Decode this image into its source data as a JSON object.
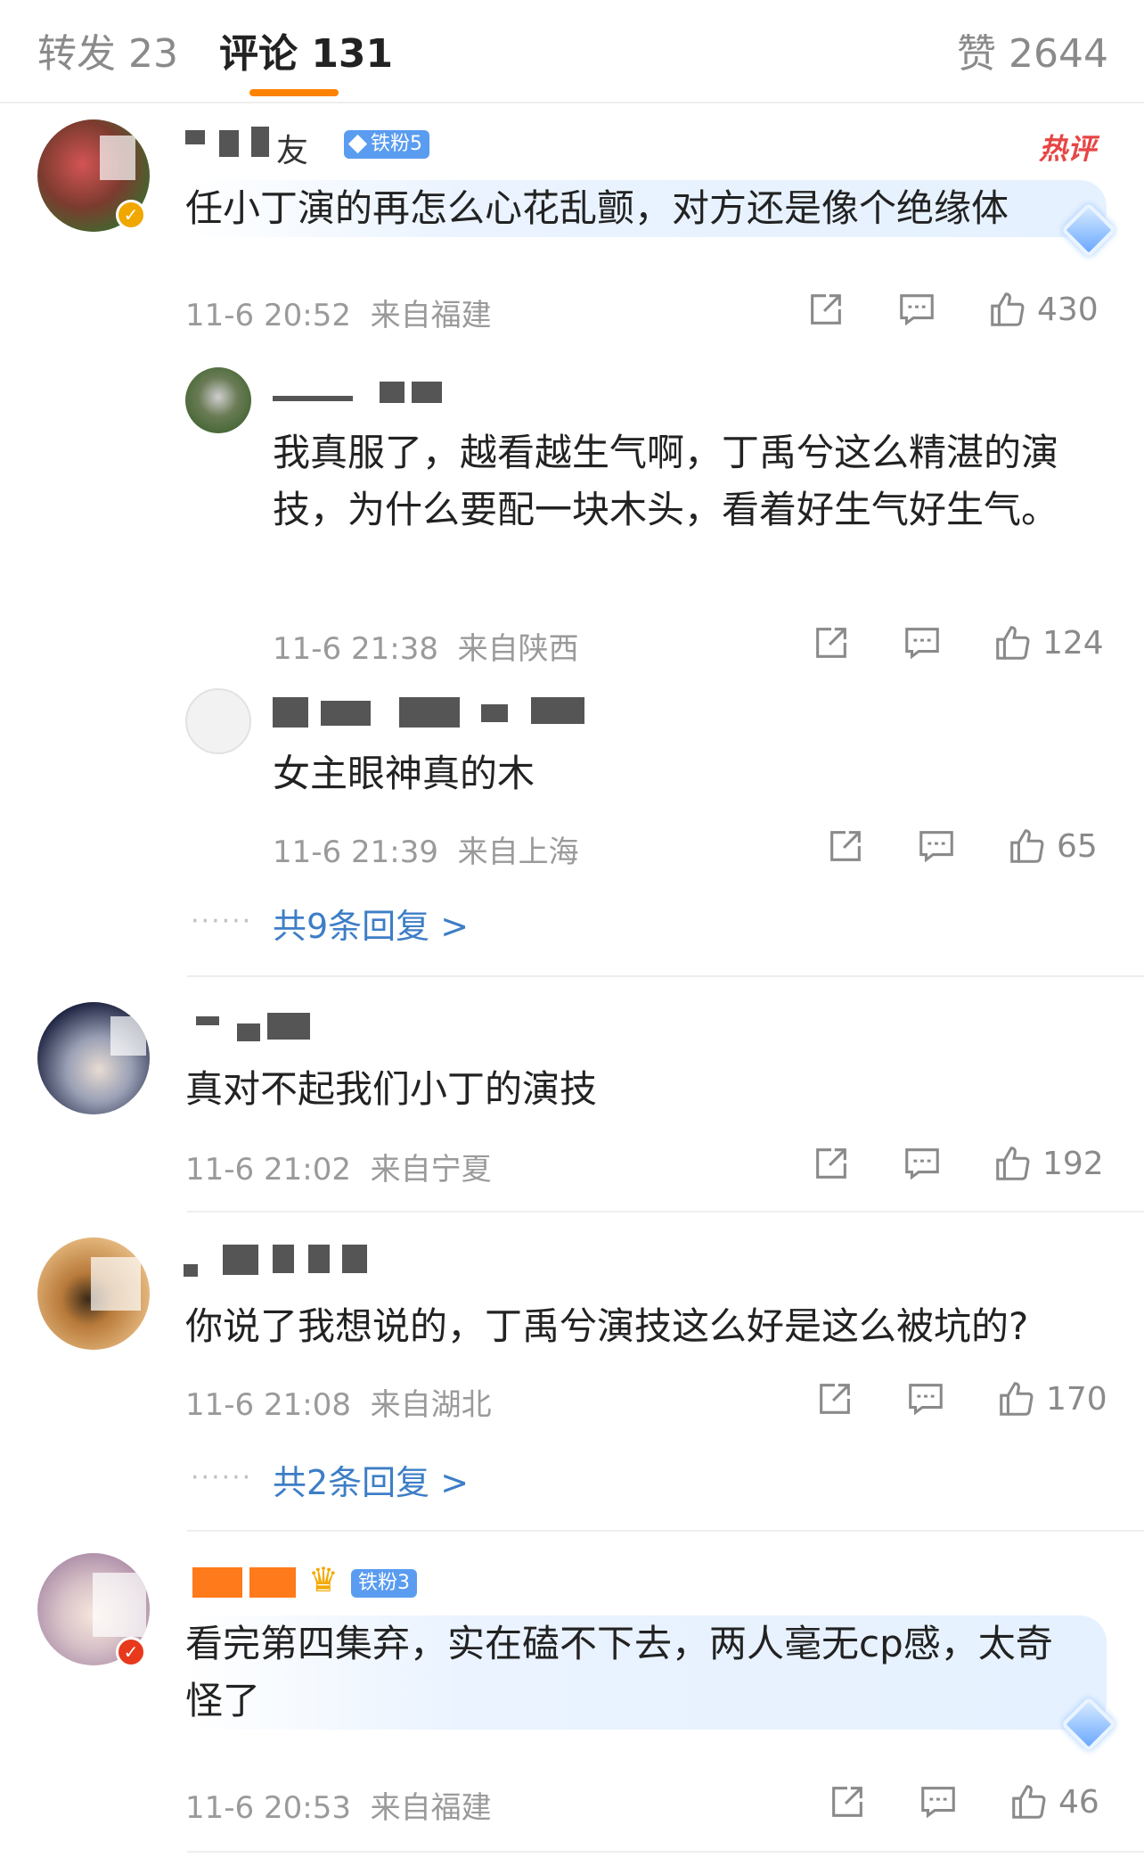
{
  "tabs": {
    "repost": "转发 23",
    "comments": "评论 131",
    "likes": "赞 2644"
  },
  "hot_label": "热评",
  "comments": [
    {
      "name": "友",
      "badge": "铁粉5",
      "text": "任小丁演的再怎么心花乱颤，对方还是像个绝缘体",
      "time": "11-6 20:52",
      "location": "来自福建",
      "likes": "430",
      "replies": [
        {
          "text": "我真服了，越看越生气啊，丁禹兮这么精湛的演技，为什么要配一块木头，看着好生气好生气。",
          "time": "11-6 21:38",
          "location": "来自陕西",
          "likes": "124"
        },
        {
          "text": "女主眼神真的木",
          "time": "11-6 21:39",
          "location": "来自上海",
          "likes": "65"
        }
      ],
      "more": "共9条回复 >"
    },
    {
      "text": "真对不起我们小丁的演技",
      "time": "11-6 21:02",
      "location": "来自宁夏",
      "likes": "192"
    },
    {
      "text": "你说了我想说的，丁禹兮演技这么好是这么被坑的?",
      "time": "11-6 21:08",
      "location": "来自湖北",
      "likes": "170",
      "more": "共2条回复 >"
    },
    {
      "badge": "铁粉3",
      "text": "看完第四集弃，实在磕不下去，两人毫无cp感，太奇怪了",
      "time": "11-6 20:53",
      "location": "来自福建",
      "likes": "46"
    }
  ],
  "colors": {
    "accent": "#ff8200",
    "link": "#3d7ec6",
    "badge": "#5a9cf0",
    "hot": "#e84545"
  }
}
